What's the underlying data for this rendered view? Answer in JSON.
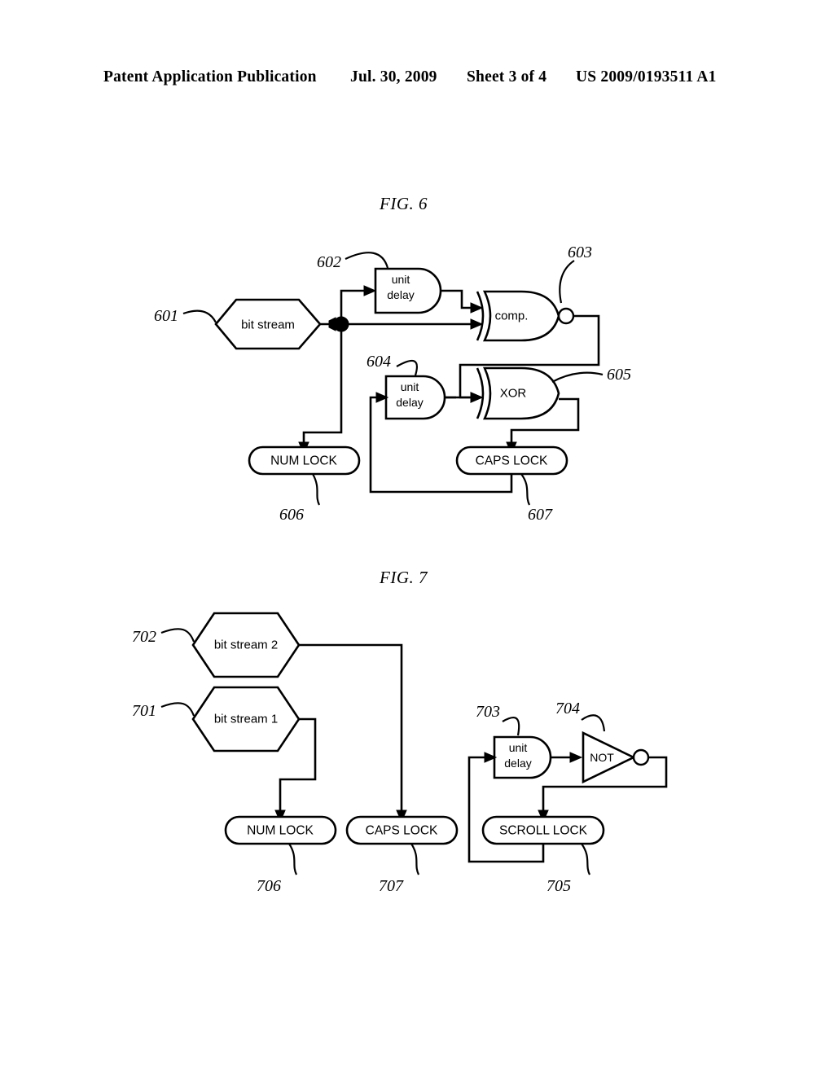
{
  "header": {
    "publication": "Patent Application Publication",
    "date": "Jul. 30, 2009",
    "sheet": "Sheet 3 of 4",
    "doc_number": "US 2009/0193511 A1"
  },
  "figures": [
    {
      "id": "fig6",
      "title": "FIG. 6",
      "nodes": {
        "bit_stream": "bit stream",
        "unit_delay_602": "unit",
        "unit_delay_602_b": "delay",
        "unit_delay_604": "unit",
        "unit_delay_604_b": "delay",
        "comparator": "comp.",
        "xor": "XOR",
        "num_lock": "NUM LOCK",
        "caps_lock": "CAPS LOCK"
      },
      "ref_numbers": {
        "r601": "601",
        "r602": "602",
        "r603": "603",
        "r604": "604",
        "r605": "605",
        "r606": "606",
        "r607": "607"
      }
    },
    {
      "id": "fig7",
      "title": "FIG. 7",
      "nodes": {
        "bit_stream_2": "bit stream 2",
        "bit_stream_1": "bit stream 1",
        "unit_delay_703": "unit",
        "unit_delay_703_b": "delay",
        "not_gate": "NOT",
        "num_lock": "NUM LOCK",
        "caps_lock": "CAPS LOCK",
        "scroll_lock": "SCROLL LOCK"
      },
      "ref_numbers": {
        "r701": "701",
        "r702": "702",
        "r703": "703",
        "r704": "704",
        "r705": "705",
        "r706": "706",
        "r707": "707"
      }
    }
  ],
  "colors": {
    "ink": "#000000",
    "paper": "#ffffff"
  }
}
